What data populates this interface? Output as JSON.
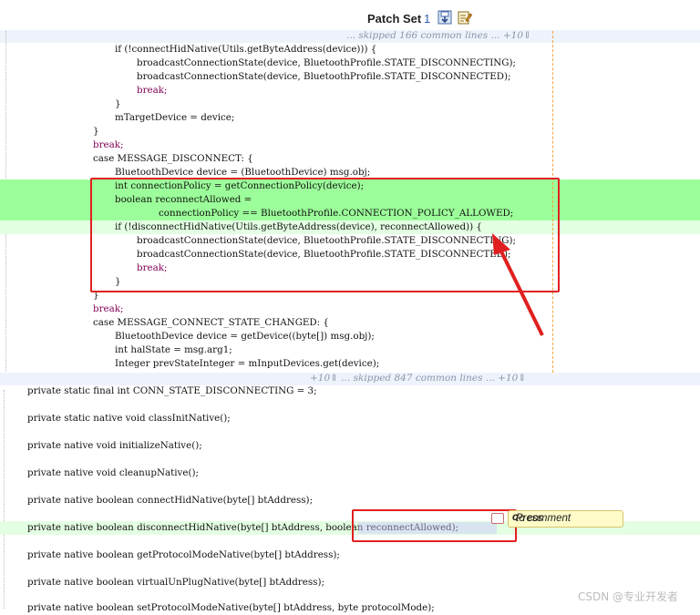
{
  "header": {
    "title": "Patch Set",
    "number": "1",
    "download_icon": "download-icon",
    "edit_icon": "edit-icon"
  },
  "skip_top": {
    "text": "... skipped 166 common lines ... +10⇓"
  },
  "skip_mid": {
    "left": "+10⇑ ... skipped 847 common lines ... +10⇓"
  },
  "upper_code": [
    "if (!connectHidNative(Utils.getByteAddress(device))) {",
    "broadcastConnectionState(device, BluetoothProfile.STATE_DISCONNECTING);",
    "broadcastConnectionState(device, BluetoothProfile.STATE_DISCONNECTED);",
    "break;",
    "}",
    "mTargetDevice = device;",
    "}",
    "break;",
    "case MESSAGE_DISCONNECT: {",
    "BluetoothDevice device = (BluetoothDevice) msg.obj;",
    "int connectionPolicy = getConnectionPolicy(device);",
    "boolean reconnectAllowed =",
    "connectionPolicy == BluetoothProfile.CONNECTION_POLICY_ALLOWED;",
    "if (!disconnectHidNative(Utils.getByteAddress(device), reconnectAllowed)) {",
    "broadcastConnectionState(device, BluetoothProfile.STATE_DISCONNECTING);",
    "broadcastConnectionState(device, BluetoothProfile.STATE_DISCONNECTED);",
    "break;",
    "}",
    "}",
    "break;",
    "case MESSAGE_CONNECT_STATE_CHANGED: {",
    "BluetoothDevice device = getDevice((byte[]) msg.obj);",
    "int halState = msg.arg1;",
    "Integer prevStateInteger = mInputDevices.get(device);"
  ],
  "lower_code": [
    "private static final int CONN_STATE_DISCONNECTING = 3;",
    "private static native void classInitNative();",
    "private native void initializeNative();",
    "private native void cleanupNative();",
    "private native boolean connectHidNative(byte[] btAddress);",
    "private native boolean disconnectHidNative(byte[] btAddress, boolean reconnectAllowed);",
    "private native boolean getProtocolModeNative(byte[] btAddress);",
    "private native boolean virtualUnPlugNative(byte[] btAddress);",
    "private native boolean setProtocolModeNative(byte[] btAddress, byte protocolMode);"
  ],
  "tooltip": {
    "prefix": "Press ",
    "key": "c",
    "suffix": " to comment"
  },
  "watermark": "CSDN @专业开发者",
  "colors": {
    "added_bg": "#9cfe9a",
    "changed_bg": "#e3ffe2",
    "annotation": "#e02020"
  }
}
